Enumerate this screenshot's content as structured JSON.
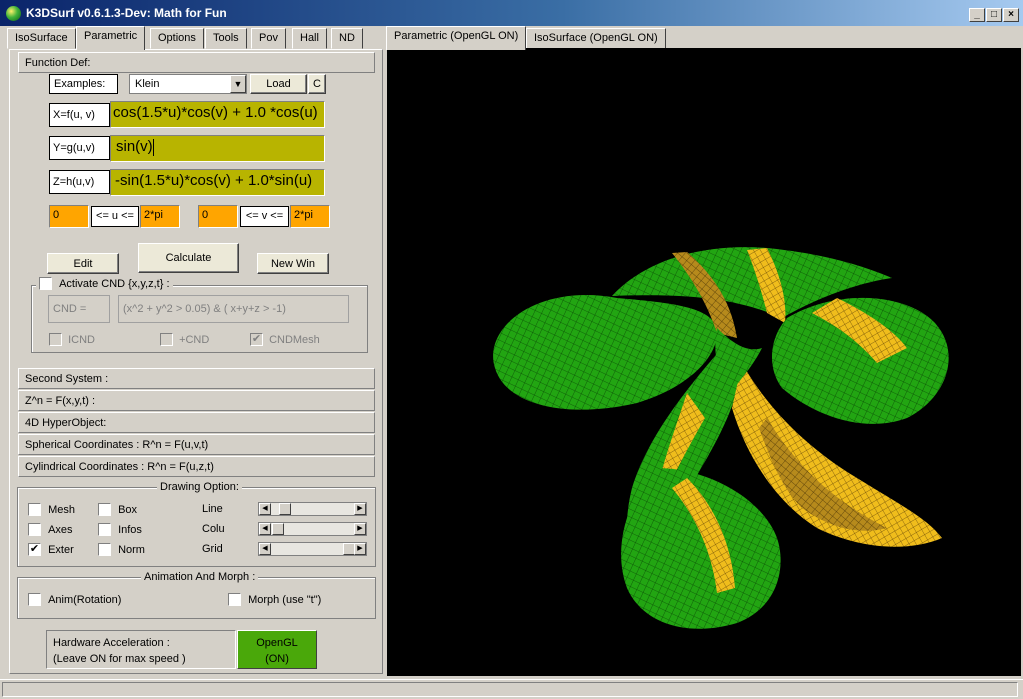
{
  "window": {
    "title": "K3DSurf v0.6.1.3-Dev: Math for Fun"
  },
  "left_tabs": [
    "IsoSurface",
    "Parametric",
    "Options",
    "Tools",
    "Pov",
    "Hall",
    "ND"
  ],
  "right_tabs": [
    "Parametric (OpenGL ON)",
    "IsoSurface (OpenGL ON)"
  ],
  "function_def": {
    "header": "Function Def:",
    "examples_label": "Examples:",
    "example_selected": "Klein",
    "load_label": "Load",
    "c_label": "C",
    "x_label": "X=f(u, v)",
    "x_value": "cos(1.5*u)*cos(v) + 1.0 *cos(u)",
    "y_label": "Y=g(u,v)",
    "y_value": "sin(v)",
    "z_label": "Z=h(u,v)",
    "z_value": "-sin(1.5*u)*cos(v) + 1.0*sin(u)",
    "u_min": "0",
    "u_label": "<= u <=",
    "u_max": "2*pi",
    "v_min": "0",
    "v_label": "<= v <=",
    "v_max": "2*pi",
    "edit_label": "Edit",
    "calculate_label": "Calculate",
    "newwin_label": "New Win",
    "cnd_activate_label": "Activate CND {x,y,z,t} :",
    "cnd_label": "CND  =",
    "cnd_value": "(x^2 + y^2 > 0.05) & ( x+y+z > -1)",
    "icnd_label": "ICND",
    "pcnd_label": "+CND",
    "cndmesh_label": "CNDMesh"
  },
  "sections": [
    "Second System :",
    "Z^n = F(x,y,t) :",
    "4D HyperObject:",
    "Spherical Coordinates : R^n = F(u,v,t)",
    "Cylindrical Coordinates : R^n = F(u,z,t)"
  ],
  "drawing": {
    "title": "Drawing Option:",
    "mesh": "Mesh",
    "box": "Box",
    "line": "Line",
    "axes": "Axes",
    "infos": "Infos",
    "colu": "Colu",
    "exter": "Exter",
    "norm": "Norm",
    "grid": "Grid",
    "exter_checked": "✔",
    "cndmesh_checked": "✔"
  },
  "anim": {
    "title": "Animation And Morph :",
    "rotation": "Anim(Rotation)",
    "morph": "Morph (use \"t\")"
  },
  "hardware": {
    "line1": "Hardware Acceleration :",
    "line2": "(Leave ON for max speed )",
    "opengl": "OpenGL",
    "state": "(ON)"
  },
  "colors": {
    "surface_green": "#1fa30f",
    "surface_yellow": "#f2c01a",
    "field": "#b8b400",
    "range": "#ffa500"
  }
}
